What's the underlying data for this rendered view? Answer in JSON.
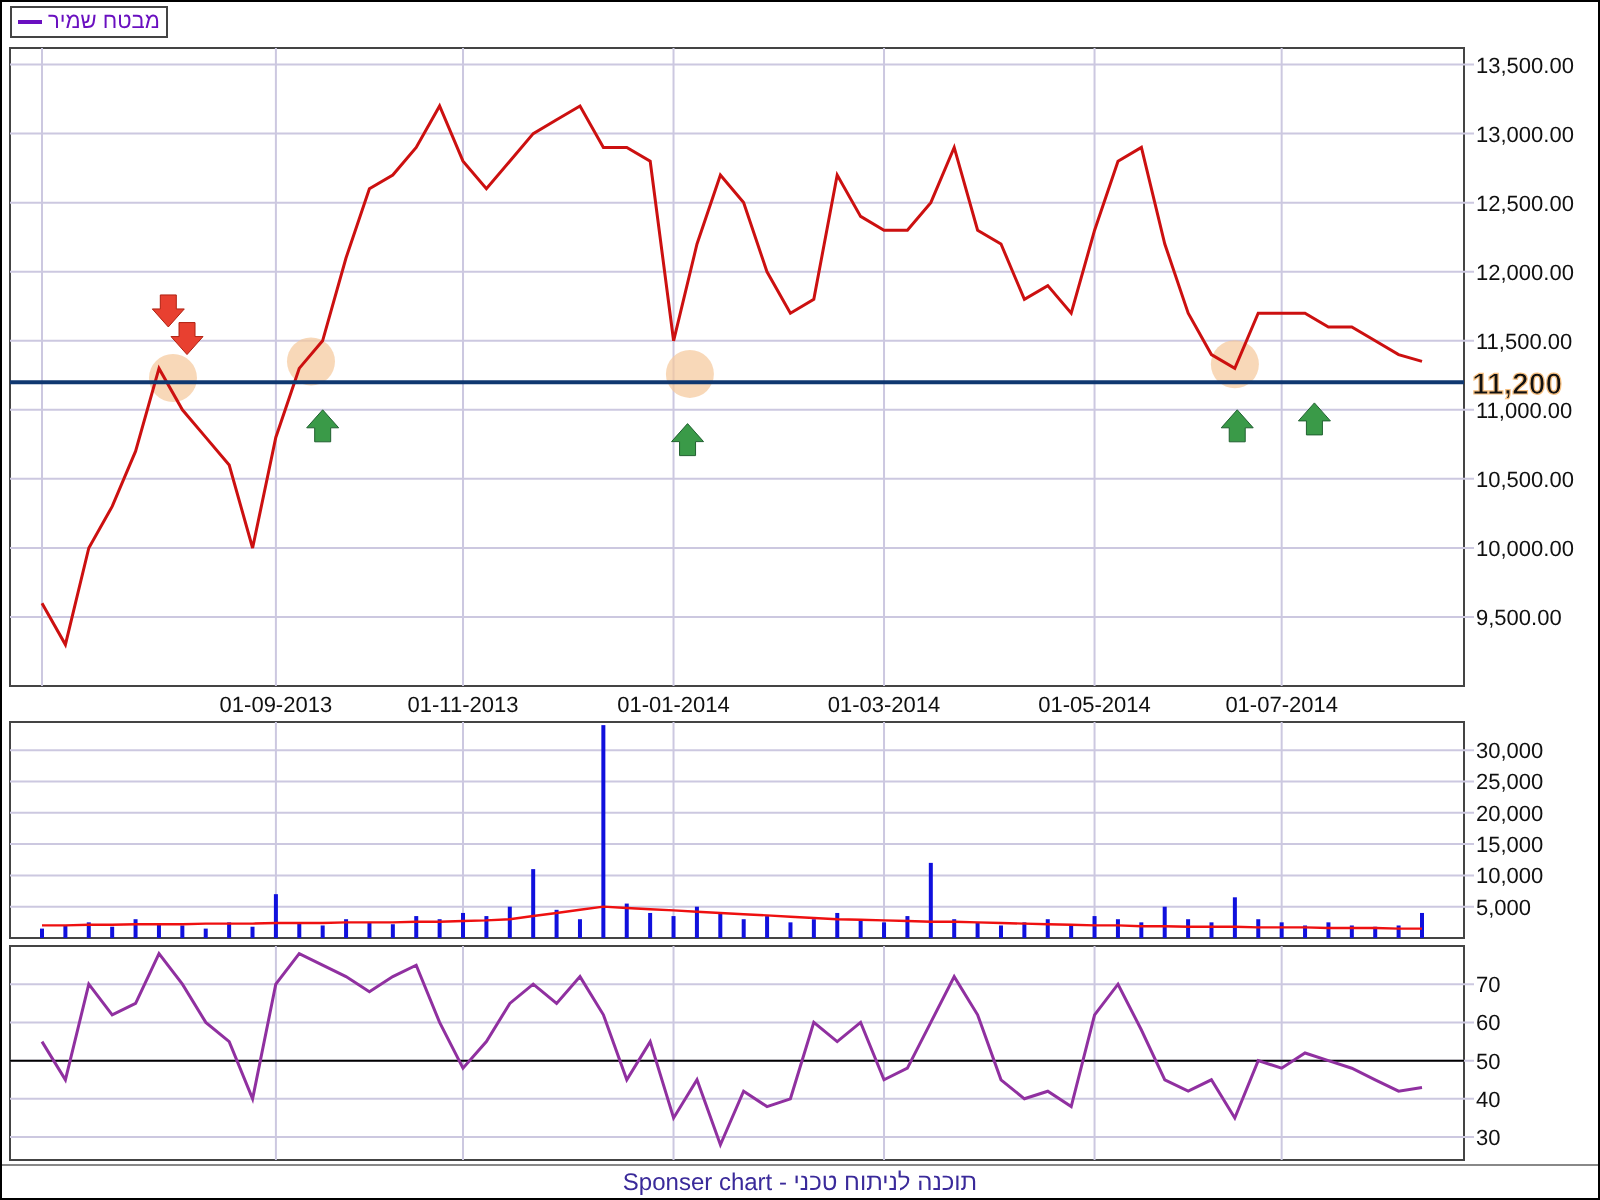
{
  "price_panel": {
    "chart_data": {
      "type": "line",
      "categories": [
        null,
        null,
        null,
        null,
        null,
        null,
        null,
        null,
        null,
        null,
        "01-09-2013",
        null,
        null,
        null,
        null,
        null,
        null,
        null,
        "01-11-2013",
        null,
        null,
        null,
        null,
        null,
        null,
        null,
        null,
        "01-01-2014",
        null,
        null,
        null,
        null,
        null,
        null,
        null,
        null,
        "01-03-2014",
        null,
        null,
        null,
        null,
        null,
        null,
        null,
        null,
        "01-05-2014",
        null,
        null,
        null,
        null,
        null,
        null,
        null,
        "01-07-2014",
        null,
        null,
        null,
        null,
        null,
        null
      ],
      "series": [
        {
          "name": "מבטח שמיר",
          "color": "#cc1010",
          "values": [
            9600,
            9300,
            10000,
            10300,
            10700,
            11300,
            11000,
            10800,
            10600,
            10000,
            10800,
            11300,
            11500,
            12100,
            12600,
            12700,
            12900,
            13200,
            12800,
            12600,
            12800,
            13000,
            13100,
            13200,
            12900,
            12900,
            12800,
            11500,
            12200,
            12700,
            12500,
            12000,
            11700,
            11800,
            12700,
            12400,
            12300,
            12300,
            12500,
            12900,
            12300,
            12200,
            11800,
            11900,
            11700,
            12300,
            12800,
            12900,
            12200,
            11700,
            11400,
            11300,
            11700,
            11700,
            11700,
            11600,
            11600,
            11500,
            11400,
            11350
          ]
        }
      ],
      "ylim": [
        9000,
        13620
      ],
      "yticks": [
        {
          "value": 9500,
          "label": "9,500.00"
        },
        {
          "value": 10000,
          "label": "10,000.00"
        },
        {
          "value": 10500,
          "label": "10,500.00"
        },
        {
          "value": 11000,
          "label": "11,000.00"
        },
        {
          "value": 11500,
          "label": "11,500.00"
        },
        {
          "value": 12000,
          "label": "12,000.00"
        },
        {
          "value": 12500,
          "label": "12,500.00"
        },
        {
          "value": 13000,
          "label": "13,000.00"
        },
        {
          "value": 13500,
          "label": "13,500.00"
        }
      ],
      "grid": true,
      "ref_lines": [
        {
          "axis": "y",
          "value": 11200,
          "label": "11,200",
          "color": "#103870"
        }
      ]
    },
    "markers": [
      {
        "kind": "circle"
      },
      {
        "kind": "circle"
      },
      {
        "kind": "circle"
      },
      {
        "kind": "circle"
      },
      {
        "kind": "arrow-down"
      },
      {
        "kind": "arrow-down"
      },
      {
        "kind": "arrow-up"
      },
      {
        "kind": "arrow-up"
      },
      {
        "kind": "arrow-up"
      },
      {
        "kind": "arrow-up"
      }
    ]
  },
  "volume_panel": {
    "chart_data": {
      "type": "bar",
      "categories": [
        null,
        null,
        null,
        null,
        null,
        null,
        null,
        null,
        null,
        null,
        null,
        null,
        null,
        null,
        null,
        null,
        null,
        null,
        null,
        null,
        null,
        null,
        null,
        null,
        null,
        null,
        null,
        null,
        null,
        null,
        null,
        null,
        null,
        null,
        null,
        null,
        null,
        null,
        null,
        null,
        null,
        null,
        null,
        null,
        null,
        null,
        null,
        null,
        null,
        null,
        null,
        null,
        null,
        null,
        null,
        null,
        null,
        null,
        null,
        null
      ],
      "series": [
        {
          "color": "#1010dd",
          "values": [
            1500,
            2000,
            2500,
            1800,
            3000,
            2200,
            2000,
            1500,
            2500,
            1800,
            7000,
            2500,
            2000,
            3000,
            2500,
            2200,
            3500,
            3000,
            4000,
            3500,
            5000,
            11000,
            4500,
            3000,
            34000,
            5500,
            4000,
            3500,
            5000,
            4000,
            3000,
            3500,
            2500,
            3000,
            4000,
            3000,
            2500,
            3500,
            12000,
            3000,
            2500,
            2000,
            2500,
            3000,
            2000,
            3500,
            3000,
            2500,
            5000,
            3000,
            2500,
            6500,
            3000,
            2500,
            2000,
            2500,
            2000,
            1800,
            2000,
            4000
          ]
        },
        {
          "type": "line",
          "color": "#ee1010",
          "values": [
            2000,
            2000,
            2100,
            2100,
            2200,
            2200,
            2200,
            2300,
            2300,
            2300,
            2400,
            2400,
            2400,
            2500,
            2500,
            2500,
            2600,
            2600,
            2700,
            2800,
            3000,
            3500,
            4000,
            4500,
            5000,
            4800,
            4600,
            4400,
            4200,
            4000,
            3800,
            3600,
            3400,
            3200,
            3000,
            2900,
            2800,
            2700,
            2600,
            2600,
            2500,
            2400,
            2300,
            2200,
            2100,
            2000,
            2000,
            1900,
            1900,
            1800,
            1800,
            1800,
            1700,
            1700,
            1700,
            1600,
            1600,
            1600,
            1500,
            1500
          ]
        }
      ],
      "ylim": [
        0,
        34500
      ],
      "grid": true,
      "yticks": [
        {
          "value": 5000,
          "label": "5,000"
        },
        {
          "value": 10000,
          "label": "10,000"
        },
        {
          "value": 15000,
          "label": "15,000"
        },
        {
          "value": 20000,
          "label": "20,000"
        },
        {
          "value": 25000,
          "label": "25,000"
        },
        {
          "value": 30000,
          "label": "30,000"
        }
      ]
    }
  },
  "rsi_panel": {
    "chart_data": {
      "type": "line",
      "categories": [
        null,
        null,
        null,
        null,
        null,
        null,
        null,
        null,
        null,
        null,
        null,
        null,
        null,
        null,
        null,
        null,
        null,
        null,
        null,
        null,
        null,
        null,
        null,
        null,
        null,
        null,
        null,
        null,
        null,
        null,
        null,
        null,
        null,
        null,
        null,
        null,
        null,
        null,
        null,
        null,
        null,
        null,
        null,
        null,
        null,
        null,
        null,
        null,
        null,
        null,
        null,
        null,
        null,
        null,
        null,
        null,
        null,
        null,
        null,
        null
      ],
      "series": [
        {
          "color": "#9030a0",
          "values": [
            55,
            45,
            70,
            62,
            65,
            78,
            70,
            60,
            55,
            40,
            70,
            78,
            75,
            72,
            68,
            72,
            75,
            60,
            48,
            55,
            65,
            70,
            65,
            72,
            62,
            45,
            55,
            35,
            45,
            28,
            42,
            38,
            40,
            60,
            55,
            60,
            45,
            48,
            60,
            72,
            62,
            45,
            40,
            42,
            38,
            62,
            70,
            58,
            45,
            42,
            45,
            35,
            50,
            48,
            52,
            50,
            48,
            45,
            42,
            43
          ]
        }
      ],
      "ylim": [
        24,
        80
      ],
      "yticks": [
        30,
        40,
        50,
        60,
        70
      ],
      "grid": true,
      "ref_lines": [
        {
          "axis": "y",
          "value": 50,
          "color": "#000000"
        }
      ]
    }
  },
  "footer": "Sponser chart - תוכנה לניתוח טכני"
}
